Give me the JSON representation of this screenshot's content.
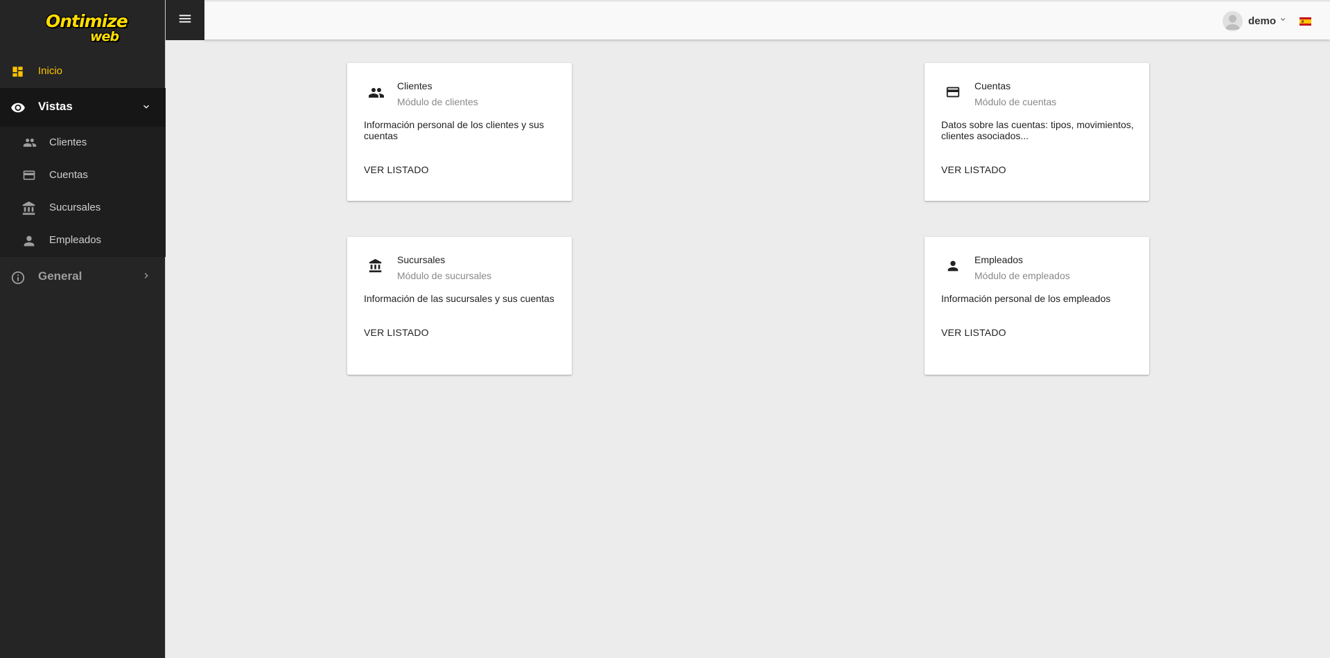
{
  "app": {
    "logo_main": "Ontimize",
    "logo_sub": "web"
  },
  "header": {
    "menu_icon": "hamburger-menu-icon",
    "user_name": "demo",
    "language_flag": "spain-flag-icon"
  },
  "sidebar": {
    "inicio": {
      "label": "Inicio",
      "icon": "dashboard-icon",
      "color": "#ffc400"
    },
    "vistas": {
      "label": "Vistas",
      "icon": "eye-icon",
      "expanded": true,
      "items": [
        {
          "label": "Clientes",
          "icon": "people-icon"
        },
        {
          "label": "Cuentas",
          "icon": "credit-card-icon"
        },
        {
          "label": "Sucursales",
          "icon": "bank-icon"
        },
        {
          "label": "Empleados",
          "icon": "person-icon"
        }
      ]
    },
    "general": {
      "label": "General",
      "icon": "info-icon",
      "expanded": false
    }
  },
  "cards": [
    {
      "title": "Clientes",
      "subtitle": "Módulo de clientes",
      "description": "Información personal de los clientes y sus cuentas",
      "action": "VER LISTADO",
      "icon": "people-icon"
    },
    {
      "title": "Cuentas",
      "subtitle": "Módulo de cuentas",
      "description": "Datos sobre las cuentas: tipos, movimientos, clientes asociados...",
      "action": "VER LISTADO",
      "icon": "credit-card-icon"
    },
    {
      "title": "Sucursales",
      "subtitle": "Módulo de sucursales",
      "description": "Información de las sucursales y sus cuentas",
      "action": "VER LISTADO",
      "icon": "bank-icon"
    },
    {
      "title": "Empleados",
      "subtitle": "Módulo de empleados",
      "description": "Información personal de los empleados",
      "action": "VER LISTADO",
      "icon": "person-icon"
    }
  ]
}
